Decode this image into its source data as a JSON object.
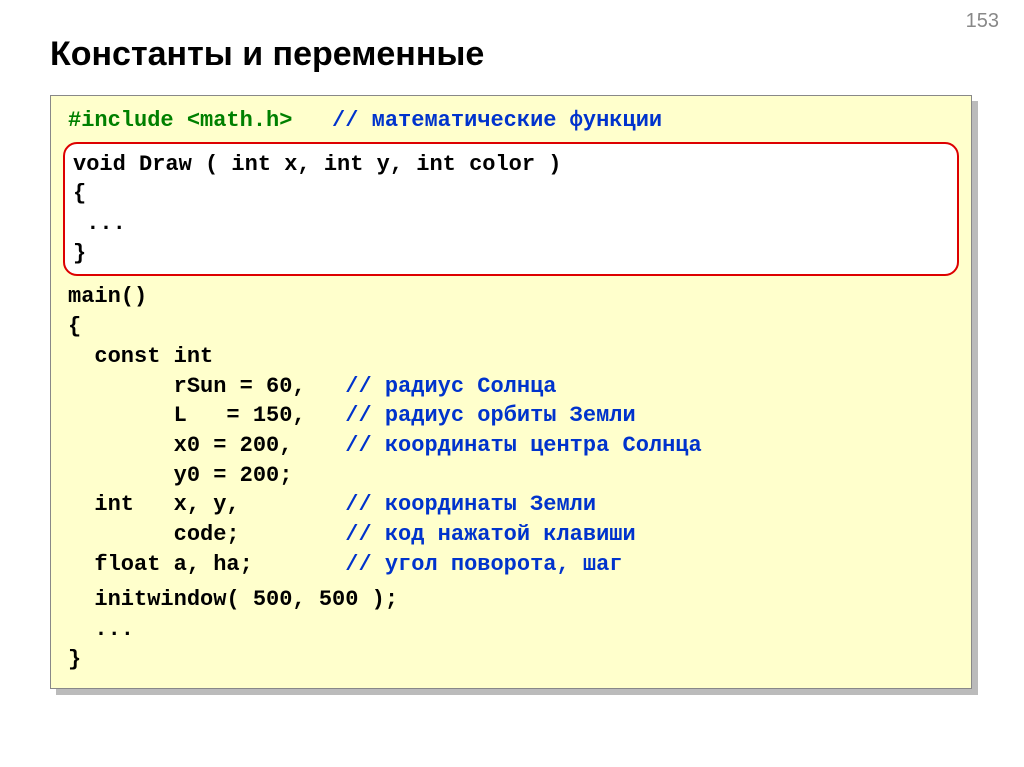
{
  "page_number": "153",
  "title": "Константы и переменные",
  "code": {
    "include": "#include <math.h>",
    "include_comment": "// математические функции",
    "draw_sig": "void Draw ( int x, int y, int color )",
    "brace_open": "{",
    "ellipsis": " ...",
    "brace_close": "}",
    "main_sig": "main()",
    "const_int": "  const int",
    "rsun": "        rSun = 60,   ",
    "rsun_c": "// радиус Солнца",
    "L": "        L   = 150,   ",
    "L_c": "// радиус орбиты Земли",
    "x0": "        x0 = 200,    ",
    "x0_c": "// координаты центра Солнца",
    "y0": "        y0 = 200;",
    "int_xy": "  int   x, y,        ",
    "int_xy_c": "// координаты Земли",
    "code_l": "        code;        ",
    "code_c": "// код нажатой клавиши",
    "float_l": "  float a, ha;       ",
    "float_c": "// угол поворота, шаг",
    "initwin": "  initwindow( 500, 500 );",
    "dots": "  ..."
  }
}
